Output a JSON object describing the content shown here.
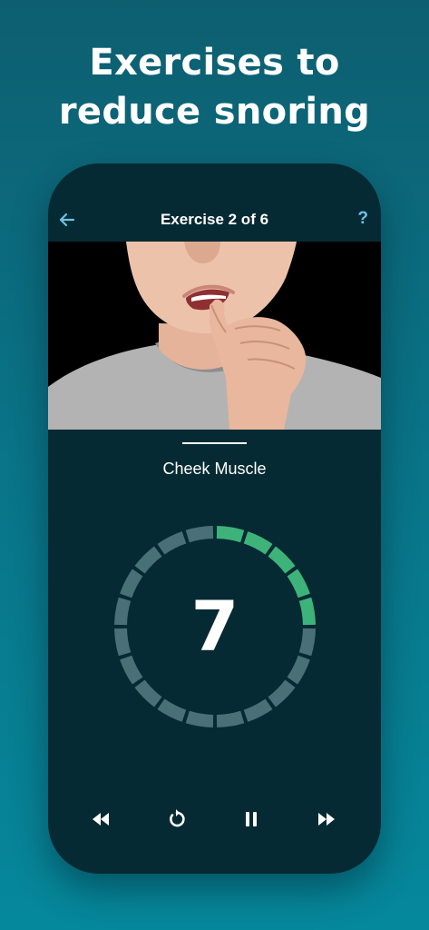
{
  "headline": {
    "line1": "Exercises to",
    "line2": "reduce snoring"
  },
  "header": {
    "title": "Exercise 2 of 6",
    "back_icon": "back-arrow-icon",
    "help_label": "?"
  },
  "exercise": {
    "name": "Cheek Muscle"
  },
  "timer": {
    "count": "7",
    "total_segments": 20,
    "completed_segments": 5,
    "active_color": "#3db37a",
    "inactive_color": "#4a7077"
  },
  "controls": [
    {
      "name": "rewind-icon"
    },
    {
      "name": "restart-icon"
    },
    {
      "name": "pause-icon"
    },
    {
      "name": "fast-forward-icon"
    }
  ],
  "colors": {
    "background_top": "#0d5f70",
    "background_bottom": "#06889c",
    "phone_screen": "#062a33",
    "accent_blue": "#6cc3e6"
  }
}
